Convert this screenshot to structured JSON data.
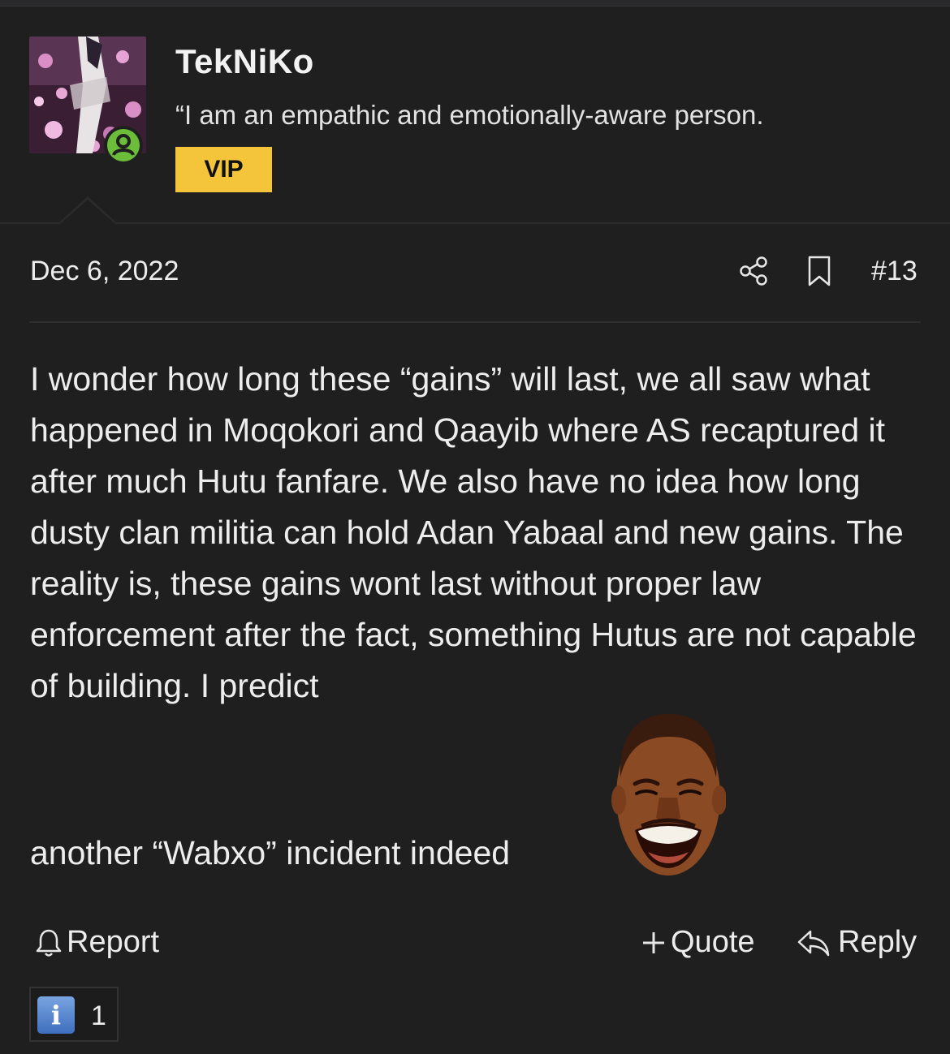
{
  "post": {
    "username": "TekNiKo",
    "user_title": "“I am an empathic and emotionally-aware person.",
    "badge": "VIP",
    "date": "Dec 6, 2022",
    "post_number": "#13",
    "body_text": "I wonder how long these “gains” will last, we all saw what happened in Moqokori and Qaayib where AS recaptured it after much Hutu fanfare. We also have no idea how long dusty clan militia can hold Adan Yabaal and new gains. The reality is, these gains wont last without proper law enforcement after the fact, something Hutus are not capable of building. I predict",
    "body_last_line": "another “Wabxo” incident indeed",
    "emoji_icon": "laughing-face-emoji"
  },
  "actions": {
    "report": "Report",
    "quote": "Quote",
    "reply": "Reply"
  },
  "reactions": {
    "icon": "information-icon",
    "icon_glyph": "i",
    "count": "1"
  },
  "colors": {
    "background": "#1f1f20",
    "vip_badge": "#f4c43a",
    "online_indicator": "#6cbd3a"
  }
}
